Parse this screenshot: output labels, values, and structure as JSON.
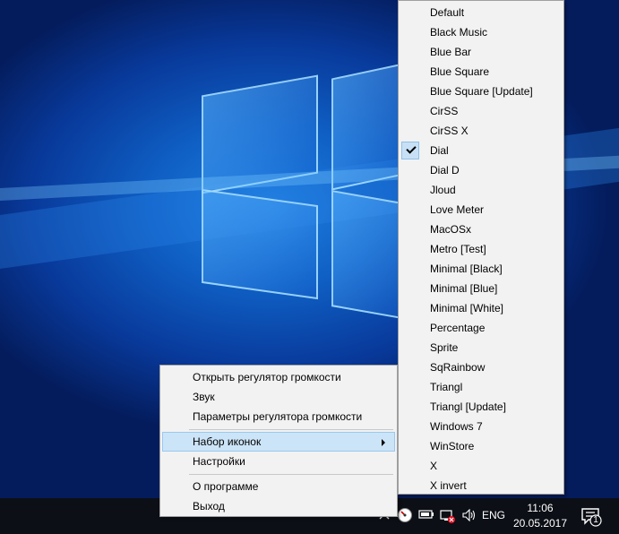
{
  "context_menu": {
    "items": [
      {
        "label": "Открыть регулятор громкости"
      },
      {
        "label": "Звук"
      },
      {
        "label": "Параметры регулятора громкости"
      },
      {
        "label": "Набор иконок",
        "has_submenu": true,
        "highlighted": true
      },
      {
        "label": "Настройки"
      },
      {
        "label": "О программе"
      },
      {
        "label": "Выход"
      }
    ]
  },
  "skin_menu": {
    "items": [
      {
        "label": "Default"
      },
      {
        "label": "Black Music"
      },
      {
        "label": "Blue Bar"
      },
      {
        "label": "Blue Square"
      },
      {
        "label": "Blue Square [Update]"
      },
      {
        "label": "CirSS"
      },
      {
        "label": "CirSS X"
      },
      {
        "label": "Dial",
        "checked": true
      },
      {
        "label": "Dial D"
      },
      {
        "label": "Jloud"
      },
      {
        "label": "Love Meter"
      },
      {
        "label": "MacOSx"
      },
      {
        "label": "Metro [Test]"
      },
      {
        "label": "Minimal [Black]"
      },
      {
        "label": "Minimal [Blue]"
      },
      {
        "label": "Minimal [White]"
      },
      {
        "label": "Percentage"
      },
      {
        "label": "Sprite"
      },
      {
        "label": "SqRainbow"
      },
      {
        "label": "Triangl"
      },
      {
        "label": "Triangl [Update]"
      },
      {
        "label": "Windows 7"
      },
      {
        "label": "WinStore"
      },
      {
        "label": "X"
      },
      {
        "label": "X invert"
      }
    ]
  },
  "taskbar": {
    "language": "ENG",
    "time": "11:06",
    "date": "20.05.2017",
    "notification_count": "1",
    "tray_icons": [
      "chevron-up-icon",
      "dial-volume-icon",
      "battery-icon",
      "network-disconnected-icon",
      "speaker-icon"
    ]
  },
  "colors": {
    "taskbar_bg": "#0c0f16",
    "menu_bg": "#f2f2f2",
    "highlight_bg": "#cce4f7",
    "highlight_border": "#99c9ef",
    "desktop_blue": "#0f5fc4"
  }
}
